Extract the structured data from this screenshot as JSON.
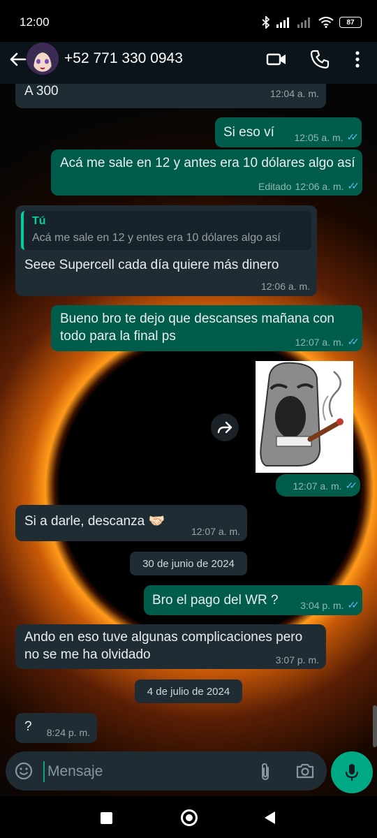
{
  "status": {
    "time": "12:00",
    "battery": "87"
  },
  "header": {
    "contact": "+52 771 330 0943",
    "icons": [
      "back-arrow-icon",
      "video-call-icon",
      "phone-icon",
      "more-vert-icon"
    ]
  },
  "messages": [
    {
      "dir": "in",
      "text": "A 300",
      "time": "12:04 a. m."
    },
    {
      "dir": "out",
      "text": "Si eso ví",
      "time": "12:05 a. m.",
      "read": true
    },
    {
      "dir": "out",
      "text": "Acá me sale en 12 y antes era 10 dólares algo así",
      "time": "12:06 a. m.",
      "edited": "Editado",
      "read": true
    },
    {
      "dir": "in",
      "quote_author": "Tú",
      "quote_text": "Acá me sale en 12 y entes era 10 dólares algo así",
      "text": "Seee Supercell cada día quiere más dinero",
      "time": "12:06 a. m."
    },
    {
      "dir": "out",
      "text": "Bueno bro te dejo que descanses mañana con todo para la final ps",
      "time": "12:07 a. m.",
      "read": true
    },
    {
      "dir": "out",
      "type": "sticker",
      "time": "12:07 a. m.",
      "read": true
    },
    {
      "dir": "in",
      "text": "Si a darle, descanza 🤝🏻",
      "time": "12:07 a. m."
    },
    {
      "type": "date",
      "text": "30 de junio de 2024"
    },
    {
      "dir": "out",
      "text": "Bro el pago del WR ?",
      "time": "3:04 p. m.",
      "read": true
    },
    {
      "dir": "in",
      "text": "Ando en eso tuve algunas complicaciones pero no se me ha olvidado",
      "time": "3:07 p. m."
    },
    {
      "type": "date",
      "text": "4 de julio de 2024"
    },
    {
      "dir": "in",
      "text": "?",
      "time": "8:24 p. m."
    }
  ],
  "composer": {
    "placeholder": "Mensaje"
  },
  "colors": {
    "incoming": "#1f2c34",
    "outgoing": "#005c4b",
    "accent": "#00a884",
    "read_ticks": "#53bdeb"
  }
}
